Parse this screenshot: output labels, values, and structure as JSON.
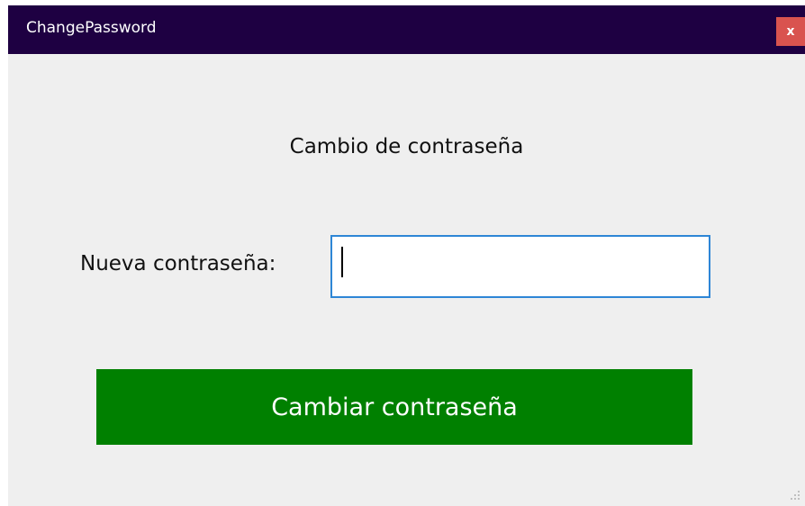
{
  "window": {
    "title": "ChangePassword",
    "close_label": "x"
  },
  "form": {
    "heading": "Cambio de contraseña",
    "password_label": "Nueva contraseña:",
    "password_value": "",
    "submit_label": "Cambiar contraseña"
  },
  "colors": {
    "titlebar": "#1e0042",
    "close_button": "#d9534f",
    "submit_button": "#008000",
    "input_border": "#2e86d6",
    "window_background": "#efefef"
  }
}
